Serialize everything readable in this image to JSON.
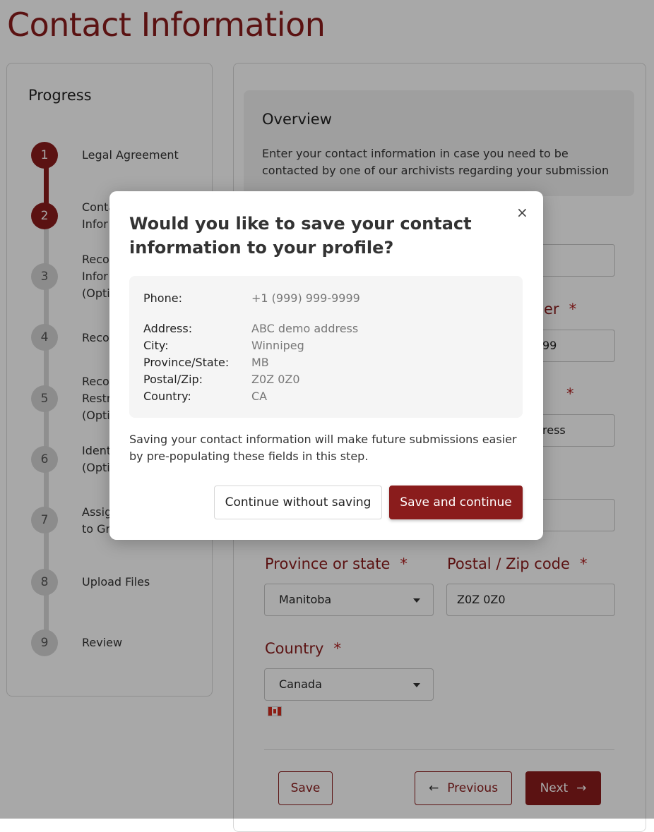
{
  "page": {
    "title": "Contact Information"
  },
  "progress": {
    "title": "Progress",
    "completed_fraction": 0.125,
    "steps": [
      {
        "number": "1",
        "label": "Legal Agreement",
        "state": "done"
      },
      {
        "number": "2",
        "label": "Conta\nInfor",
        "state": "current"
      },
      {
        "number": "3",
        "label": "Reco\nInfor\n(Opti",
        "state": "todo"
      },
      {
        "number": "4",
        "label": "Reco",
        "state": "todo"
      },
      {
        "number": "5",
        "label": "Reco\nRestr\n(Opti",
        "state": "todo"
      },
      {
        "number": "6",
        "label": "Ident\n(Opti",
        "state": "todo"
      },
      {
        "number": "7",
        "label": "Assig\nto Gr",
        "state": "todo"
      },
      {
        "number": "8",
        "label": "Upload Files",
        "state": "todo"
      },
      {
        "number": "9",
        "label": "Review",
        "state": "todo"
      }
    ]
  },
  "overview": {
    "title": "Overview",
    "text": "Enter your contact information in case you need to be contacted by one of our archivists regarding your submission"
  },
  "form": {
    "phone_label_fragment": "er",
    "phone_value_fragment": "99",
    "address_value_fragment": "ress",
    "required_marker": "*",
    "province_label": "Province or state",
    "province_value": "Manitoba",
    "postal_label": "Postal / Zip code",
    "postal_value": "Z0Z 0Z0",
    "country_label": "Country",
    "country_value": "Canada"
  },
  "nav": {
    "save_label": "Save",
    "previous_label": "Previous",
    "next_label": "Next"
  },
  "modal": {
    "close_glyph": "×",
    "title": "Would you like to save your contact information to your profile?",
    "summary": {
      "phone_key": "Phone:",
      "phone_value": "+1 (999) 999-9999",
      "address_key": "Address:",
      "address_value": "ABC demo address",
      "city_key": "City:",
      "city_value": "Winnipeg",
      "province_key": "Province/State:",
      "province_value": "MB",
      "postal_key": "Postal/Zip:",
      "postal_value": "Z0Z 0Z0",
      "country_key": "Country:",
      "country_value": "CA"
    },
    "text": "Saving your contact information will make future submissions easier by pre-populating these fields in this step.",
    "continue_label": "Continue without saving",
    "save_label": "Save and continue"
  },
  "colors": {
    "brand": "#8a1c1c",
    "overlay": "rgba(0,0,0,0.34)"
  },
  "icons": {
    "close": "close-icon",
    "dropdown": "chevron-down-icon",
    "previous": "arrow-left-icon",
    "next": "arrow-right-icon",
    "flag": "canada-flag-icon"
  }
}
